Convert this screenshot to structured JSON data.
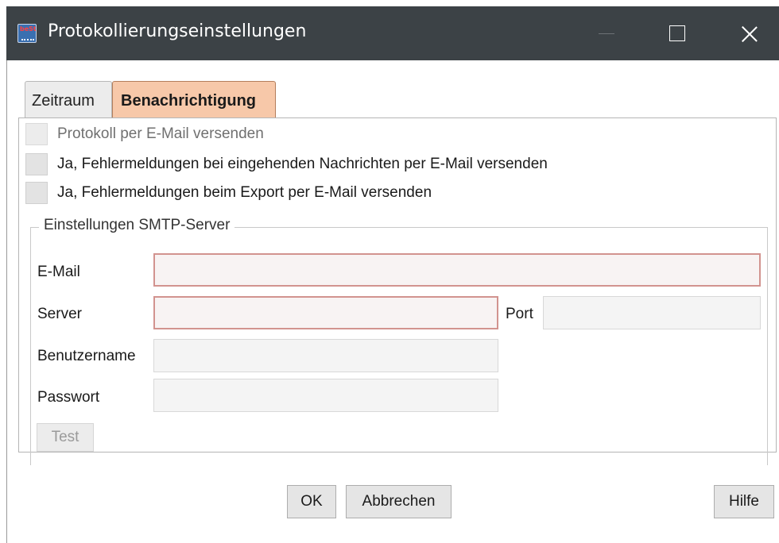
{
  "window": {
    "title": "Protokollierungseinstellungen",
    "icon": "best-app-icon",
    "icon_text": "beSt",
    "title_bar_color": "#3c4246"
  },
  "tabs": [
    {
      "label": "Zeitraum",
      "active": false
    },
    {
      "label": "Benachrichtigung",
      "active": true
    }
  ],
  "checkboxes": [
    {
      "label": "Protokoll per E-Mail versenden",
      "checked": false,
      "enabled": false
    },
    {
      "label": "Ja, Fehlermeldungen bei eingehenden Nachrichten per E-Mail versenden",
      "checked": false,
      "enabled": true
    },
    {
      "label": "Ja, Fehlermeldungen beim Export per E-Mail versenden",
      "checked": false,
      "enabled": true
    }
  ],
  "smtp": {
    "group_label": "Einstellungen SMTP-Server",
    "email_label": "E-Mail",
    "email_value": "",
    "server_label": "Server",
    "server_value": "",
    "port_label": "Port",
    "port_value": "",
    "username_label": "Benutzername",
    "username_value": "",
    "password_label": "Passwort",
    "password_value": "",
    "test_label": "Test",
    "error_color": "#d2938f"
  },
  "buttons": {
    "ok": "OK",
    "cancel": "Abbrechen",
    "help": "Hilfe"
  },
  "colors": {
    "active_tab": "#f7c8a9"
  }
}
